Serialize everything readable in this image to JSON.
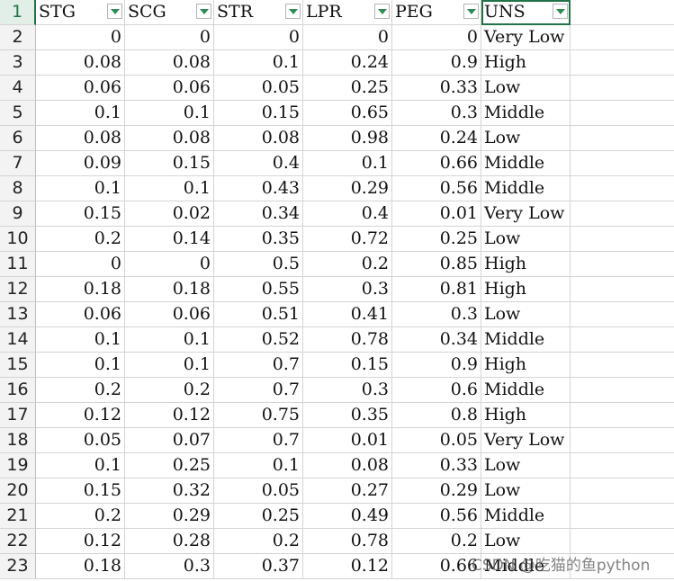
{
  "sheet": {
    "header_row_number": "1",
    "columns": [
      "STG",
      "SCG",
      "STR",
      "LPR",
      "PEG",
      "UNS"
    ],
    "rows": [
      {
        "n": "2",
        "v": [
          "0",
          "0",
          "0",
          "0",
          "0",
          "Very Low"
        ]
      },
      {
        "n": "3",
        "v": [
          "0.08",
          "0.08",
          "0.1",
          "0.24",
          "0.9",
          "High"
        ]
      },
      {
        "n": "4",
        "v": [
          "0.06",
          "0.06",
          "0.05",
          "0.25",
          "0.33",
          "Low"
        ]
      },
      {
        "n": "5",
        "v": [
          "0.1",
          "0.1",
          "0.15",
          "0.65",
          "0.3",
          "Middle"
        ]
      },
      {
        "n": "6",
        "v": [
          "0.08",
          "0.08",
          "0.08",
          "0.98",
          "0.24",
          "Low"
        ]
      },
      {
        "n": "7",
        "v": [
          "0.09",
          "0.15",
          "0.4",
          "0.1",
          "0.66",
          "Middle"
        ]
      },
      {
        "n": "8",
        "v": [
          "0.1",
          "0.1",
          "0.43",
          "0.29",
          "0.56",
          "Middle"
        ]
      },
      {
        "n": "9",
        "v": [
          "0.15",
          "0.02",
          "0.34",
          "0.4",
          "0.01",
          "Very Low"
        ]
      },
      {
        "n": "10",
        "v": [
          "0.2",
          "0.14",
          "0.35",
          "0.72",
          "0.25",
          "Low"
        ]
      },
      {
        "n": "11",
        "v": [
          "0",
          "0",
          "0.5",
          "0.2",
          "0.85",
          "High"
        ]
      },
      {
        "n": "12",
        "v": [
          "0.18",
          "0.18",
          "0.55",
          "0.3",
          "0.81",
          "High"
        ]
      },
      {
        "n": "13",
        "v": [
          "0.06",
          "0.06",
          "0.51",
          "0.41",
          "0.3",
          "Low"
        ]
      },
      {
        "n": "14",
        "v": [
          "0.1",
          "0.1",
          "0.52",
          "0.78",
          "0.34",
          "Middle"
        ]
      },
      {
        "n": "15",
        "v": [
          "0.1",
          "0.1",
          "0.7",
          "0.15",
          "0.9",
          "High"
        ]
      },
      {
        "n": "16",
        "v": [
          "0.2",
          "0.2",
          "0.7",
          "0.3",
          "0.6",
          "Middle"
        ]
      },
      {
        "n": "17",
        "v": [
          "0.12",
          "0.12",
          "0.75",
          "0.35",
          "0.8",
          "High"
        ]
      },
      {
        "n": "18",
        "v": [
          "0.05",
          "0.07",
          "0.7",
          "0.01",
          "0.05",
          "Very Low"
        ]
      },
      {
        "n": "19",
        "v": [
          "0.1",
          "0.25",
          "0.1",
          "0.08",
          "0.33",
          "Low"
        ]
      },
      {
        "n": "20",
        "v": [
          "0.15",
          "0.32",
          "0.05",
          "0.27",
          "0.29",
          "Low"
        ]
      },
      {
        "n": "21",
        "v": [
          "0.2",
          "0.29",
          "0.25",
          "0.49",
          "0.56",
          "Middle"
        ]
      },
      {
        "n": "22",
        "v": [
          "0.12",
          "0.28",
          "0.2",
          "0.78",
          "0.2",
          "Low"
        ]
      },
      {
        "n": "23",
        "v": [
          "0.18",
          "0.3",
          "0.37",
          "0.12",
          "0.66",
          "Middle"
        ]
      }
    ],
    "filter_icon": "chevron-down-icon",
    "accent_color": "#217346"
  },
  "watermark": "CSDN @吃猫的鱼python"
}
